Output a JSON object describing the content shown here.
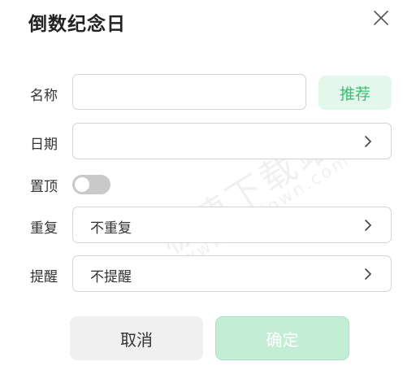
{
  "dialog": {
    "title": "倒数纪念日",
    "close_icon": "close-icon"
  },
  "form": {
    "name": {
      "label": "名称",
      "value": "",
      "placeholder": "",
      "recommend_label": "推荐"
    },
    "date": {
      "label": "日期",
      "value": "",
      "chevron_icon": "chevron-right-icon"
    },
    "pin_top": {
      "label": "置顶",
      "enabled": false
    },
    "repeat": {
      "label": "重复",
      "value": "不重复",
      "chevron_icon": "chevron-right-icon"
    },
    "reminder": {
      "label": "提醒",
      "value": "不提醒",
      "chevron_icon": "chevron-right-icon"
    }
  },
  "actions": {
    "cancel_label": "取消",
    "confirm_label": "确定"
  },
  "watermark": {
    "line1": "极速下载站",
    "line2": "www.mydown.com"
  },
  "colors": {
    "accent_green": "#3bbf72",
    "recommend_bg": "#e4f7ec",
    "confirm_bg": "#c3eed5",
    "cancel_bg": "#f0f0f0",
    "toggle_off": "#c9c9c9",
    "border": "#d3d3d3"
  }
}
